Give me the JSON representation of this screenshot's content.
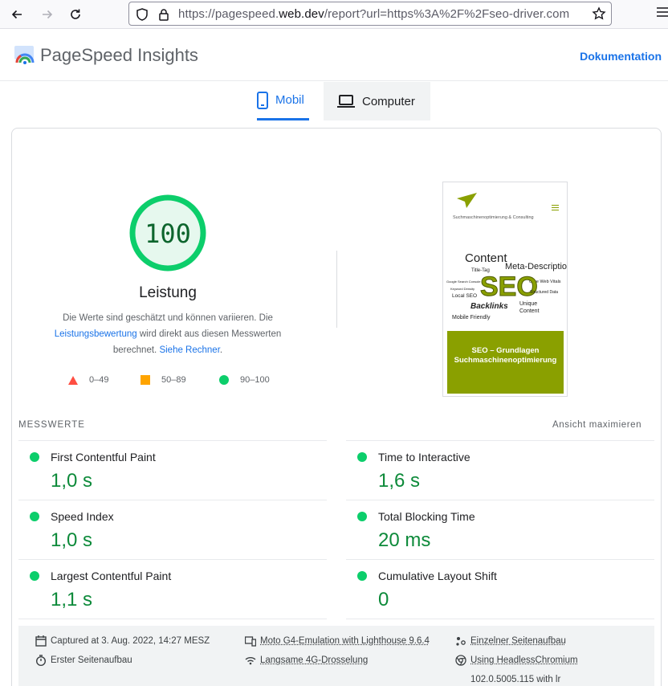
{
  "browser": {
    "url_prefix": "https://pagespeed.",
    "url_domain": "web.dev",
    "url_rest": "/report?url=https%3A%2F%2Fseo-driver.com"
  },
  "header": {
    "title": "PageSpeed Insights",
    "doc_link": "Dokumentation"
  },
  "tabs": [
    {
      "label": "Mobil",
      "active": true
    },
    {
      "label": "Computer",
      "active": false
    }
  ],
  "score": {
    "value": "100",
    "label": "Leistung",
    "desc_1": "Die Werte sind geschätzt und können variieren. Die",
    "desc_link_1": "Leistungsbewertung",
    "desc_2": " wird direkt aus diesen Messwerten berechnet.",
    "desc_link_2": "Siehe Rechner",
    "desc_3": ".",
    "ring_color": "#0cce6b",
    "fill_color": "#e6f8ee"
  },
  "legend": [
    {
      "range": "0–49",
      "color": "#ff4e42",
      "shape": "triangle"
    },
    {
      "range": "50–89",
      "color": "#ffa400",
      "shape": "square"
    },
    {
      "range": "90–100",
      "color": "#0cce6b",
      "shape": "circle"
    }
  ],
  "thumbnail": {
    "tagline": "Suchmaschinenoptimierung & Consulting",
    "words": {
      "content": "Content",
      "meta": "Meta-Description",
      "title_tag": "Title-Tag",
      "google": "Google Search Console",
      "cwv": "Core Web Vitals",
      "keyword": "Keyword Density",
      "seo": "SEO",
      "structured": "Structured Data",
      "local": "Local SEO",
      "backlinks": "Backlinks",
      "unique": "Unique",
      "unique2": "Content",
      "mobile": "Mobile Friendly"
    },
    "band_line1": "SEO – Grundlagen",
    "band_line2": "Suchmaschinenoptimierung",
    "accent": "#8aa000"
  },
  "metrics": {
    "heading": "MESSWERTE",
    "expand": "Ansicht maximieren",
    "items": [
      {
        "name": "First Contentful Paint",
        "value": "1,0 s"
      },
      {
        "name": "Time to Interactive",
        "value": "1,6 s"
      },
      {
        "name": "Speed Index",
        "value": "1,0 s"
      },
      {
        "name": "Total Blocking Time",
        "value": "20 ms"
      },
      {
        "name": "Largest Contentful Paint",
        "value": "1,1 s"
      },
      {
        "name": "Cumulative Layout Shift",
        "value": "0"
      }
    ]
  },
  "info": {
    "captured": "Captured at 3. Aug. 2022, 14:27 MESZ",
    "first_load": "Erster Seitenaufbau",
    "device": "Moto G4-Emulation with Lighthouse 9.6.4",
    "throttling": "Langsame 4G-Drosselung",
    "single_load": "Einzelner Seitenaufbau",
    "browser": "Using HeadlessChromium",
    "browser_version": "102.0.5005.115 with lr"
  }
}
